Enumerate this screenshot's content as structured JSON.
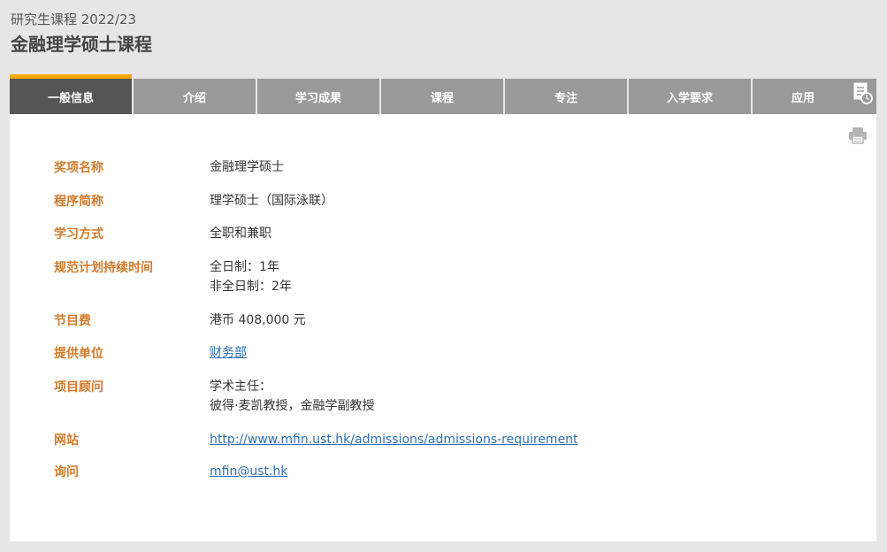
{
  "header": {
    "breadcrumb": "研究生课程 2022/23",
    "title": "金融理学硕士课程"
  },
  "tabs": [
    {
      "label": "一般信息",
      "active": true
    },
    {
      "label": "介绍",
      "active": false
    },
    {
      "label": "学习成果",
      "active": false
    },
    {
      "label": "课程",
      "active": false
    },
    {
      "label": "专注",
      "active": false
    },
    {
      "label": "入学要求",
      "active": false
    },
    {
      "label": "应用",
      "active": false
    }
  ],
  "icons": {
    "tab_extra": "document-clock-icon",
    "print": "print-icon"
  },
  "colors": {
    "label": "#d27a2c",
    "active_tab": "#555555",
    "tab_accent": "#f5a800",
    "link": "#2f6fb6"
  },
  "info": {
    "award_label": "奖项名称",
    "award_value": "金融理学硕士",
    "short_label": "程序简称",
    "short_value": "理学硕士（国际泳联）",
    "mode_label": "学习方式",
    "mode_value": "全职和兼职",
    "duration_label": "规范计划持续时间",
    "duration_line1": "全日制：1年",
    "duration_line2": "非全日制：2年",
    "fee_label": "节目费",
    "fee_value": "港币 408,000 元",
    "unit_label": "提供单位",
    "unit_value": "财务部",
    "advisor_label": "项目顾问",
    "advisor_line1": "学术主任：",
    "advisor_line2": "彼得·麦凯教授，金融学副教授",
    "website_label": "网站",
    "website_value": "http://www.mfin.ust.hk/admissions/admissions-requirement",
    "enquiry_label": "询问",
    "enquiry_value": "mfin@ust.hk"
  }
}
